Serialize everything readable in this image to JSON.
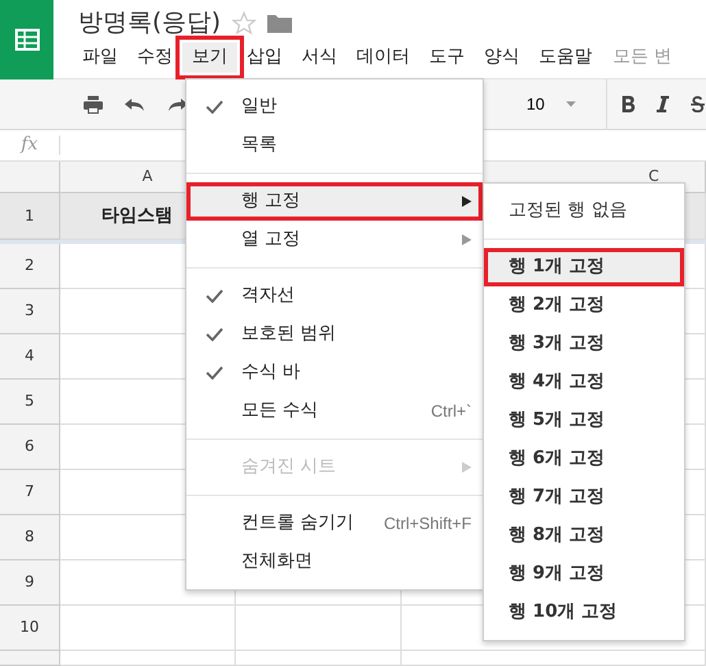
{
  "document": {
    "title": "방명록(응답)"
  },
  "menu_bar": [
    {
      "label": "파일",
      "selected": false,
      "annotated": false
    },
    {
      "label": "수정",
      "selected": false,
      "annotated": false
    },
    {
      "label": "보기",
      "selected": true,
      "annotated": true
    },
    {
      "label": "삽입",
      "selected": false,
      "annotated": false
    },
    {
      "label": "서식",
      "selected": false,
      "annotated": false
    },
    {
      "label": "데이터",
      "selected": false,
      "annotated": false
    },
    {
      "label": "도구",
      "selected": false,
      "annotated": false
    },
    {
      "label": "양식",
      "selected": false,
      "annotated": false
    },
    {
      "label": "도움말",
      "selected": false,
      "annotated": false
    }
  ],
  "save_status": "모든 변",
  "toolbar": {
    "font_size": "10"
  },
  "formula_bar": {
    "label": "fx"
  },
  "sheet": {
    "column_a": "A",
    "column_c": "C",
    "header_cell": "타임스탬",
    "row_numbers": [
      "1",
      "2",
      "3",
      "4",
      "5",
      "6",
      "7",
      "8",
      "9",
      "10"
    ]
  },
  "view_menu": [
    {
      "kind": "item",
      "label": "일반",
      "checked": true,
      "selected": false,
      "annotated": false,
      "disabled": false,
      "submenu": false
    },
    {
      "kind": "item",
      "label": "목록",
      "checked": false,
      "selected": false,
      "annotated": false,
      "disabled": false,
      "submenu": false
    },
    {
      "kind": "separator"
    },
    {
      "kind": "item",
      "label": "행 고정",
      "checked": false,
      "selected": true,
      "annotated": true,
      "disabled": false,
      "submenu": true
    },
    {
      "kind": "item",
      "label": "열 고정",
      "checked": false,
      "selected": false,
      "annotated": false,
      "disabled": false,
      "submenu": true
    },
    {
      "kind": "separator"
    },
    {
      "kind": "item",
      "label": "격자선",
      "checked": true,
      "selected": false,
      "annotated": false,
      "disabled": false,
      "submenu": false
    },
    {
      "kind": "item",
      "label": "보호된 범위",
      "checked": true,
      "selected": false,
      "annotated": false,
      "disabled": false,
      "submenu": false
    },
    {
      "kind": "item",
      "label": "수식 바",
      "checked": true,
      "selected": false,
      "annotated": false,
      "disabled": false,
      "submenu": false
    },
    {
      "kind": "item",
      "label": "모든 수식",
      "shortcut": "Ctrl+`",
      "checked": false,
      "selected": false,
      "annotated": false,
      "disabled": false,
      "submenu": false
    },
    {
      "kind": "separator"
    },
    {
      "kind": "item",
      "label": "숨겨진 시트",
      "checked": false,
      "selected": false,
      "annotated": false,
      "disabled": true,
      "submenu": true
    },
    {
      "kind": "separator"
    },
    {
      "kind": "item",
      "label": "컨트롤 숨기기",
      "shortcut": "Ctrl+Shift+F",
      "checked": false,
      "selected": false,
      "annotated": false,
      "disabled": false,
      "submenu": false
    },
    {
      "kind": "item",
      "label": "전체화면",
      "checked": false,
      "selected": false,
      "annotated": false,
      "disabled": false,
      "submenu": false
    }
  ],
  "freeze_rows_submenu": [
    {
      "kind": "item",
      "label": "고정된 행 없음",
      "bold": false,
      "selected": false,
      "annotated": false
    },
    {
      "kind": "separator"
    },
    {
      "kind": "item",
      "label": "행 1개 고정",
      "bold": true,
      "selected": true,
      "annotated": true
    },
    {
      "kind": "item",
      "label": "행 2개 고정",
      "bold": true,
      "selected": false,
      "annotated": false
    },
    {
      "kind": "item",
      "label": "행 3개 고정",
      "bold": true,
      "selected": false,
      "annotated": false
    },
    {
      "kind": "item",
      "label": "행 4개 고정",
      "bold": true,
      "selected": false,
      "annotated": false
    },
    {
      "kind": "item",
      "label": "행 5개 고정",
      "bold": true,
      "selected": false,
      "annotated": false
    },
    {
      "kind": "item",
      "label": "행 6개 고정",
      "bold": true,
      "selected": false,
      "annotated": false
    },
    {
      "kind": "item",
      "label": "행 7개 고정",
      "bold": true,
      "selected": false,
      "annotated": false
    },
    {
      "kind": "item",
      "label": "행 8개 고정",
      "bold": true,
      "selected": false,
      "annotated": false
    },
    {
      "kind": "item",
      "label": "행 9개 고정",
      "bold": true,
      "selected": false,
      "annotated": false
    },
    {
      "kind": "item",
      "label": "행 10개 고정",
      "bold": true,
      "selected": false,
      "annotated": false
    }
  ]
}
